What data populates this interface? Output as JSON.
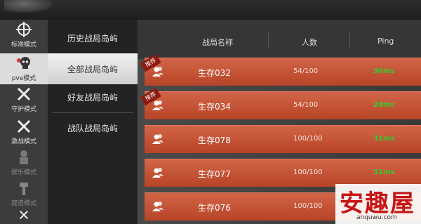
{
  "modes": [
    {
      "label": "标准模式",
      "icon": "crosshair-icon"
    },
    {
      "label": "pve模式",
      "icon": "skull-icon"
    },
    {
      "label": "守护模式",
      "icon": "crossed-swords-icon"
    },
    {
      "label": "激战模式",
      "icon": "crossed-swords-icon"
    },
    {
      "label": "娱乐模式",
      "icon": "soldier-icon"
    },
    {
      "label": "建造模式",
      "icon": "tools-icon"
    }
  ],
  "submenu": [
    {
      "label": "历史战局岛屿"
    },
    {
      "label": "全部战局岛屿"
    },
    {
      "label": "好友战局岛屿"
    },
    {
      "label": "战队战局岛屿"
    }
  ],
  "table": {
    "headers": {
      "name": "战局名称",
      "count": "人数",
      "ping": "Ping"
    },
    "rows": [
      {
        "name": "生存032",
        "count": "54/100",
        "ping": "30ms",
        "recommended": true
      },
      {
        "name": "生存034",
        "count": "54/100",
        "ping": "28ms",
        "recommended": true
      },
      {
        "name": "生存078",
        "count": "100/100",
        "ping": "31ms",
        "recommended": false
      },
      {
        "name": "生存077",
        "count": "100/100",
        "ping": "31ms",
        "recommended": false
      },
      {
        "name": "生存076",
        "count": "100/100",
        "ping": "",
        "recommended": false
      }
    ]
  },
  "recommend_badge": "推荐",
  "watermark": {
    "text": "安趣屋",
    "url": "anquwu.com"
  },
  "colors": {
    "row": "#c4512f",
    "ping": "#2fcf2f",
    "active_tab": "#dcdcdc"
  }
}
